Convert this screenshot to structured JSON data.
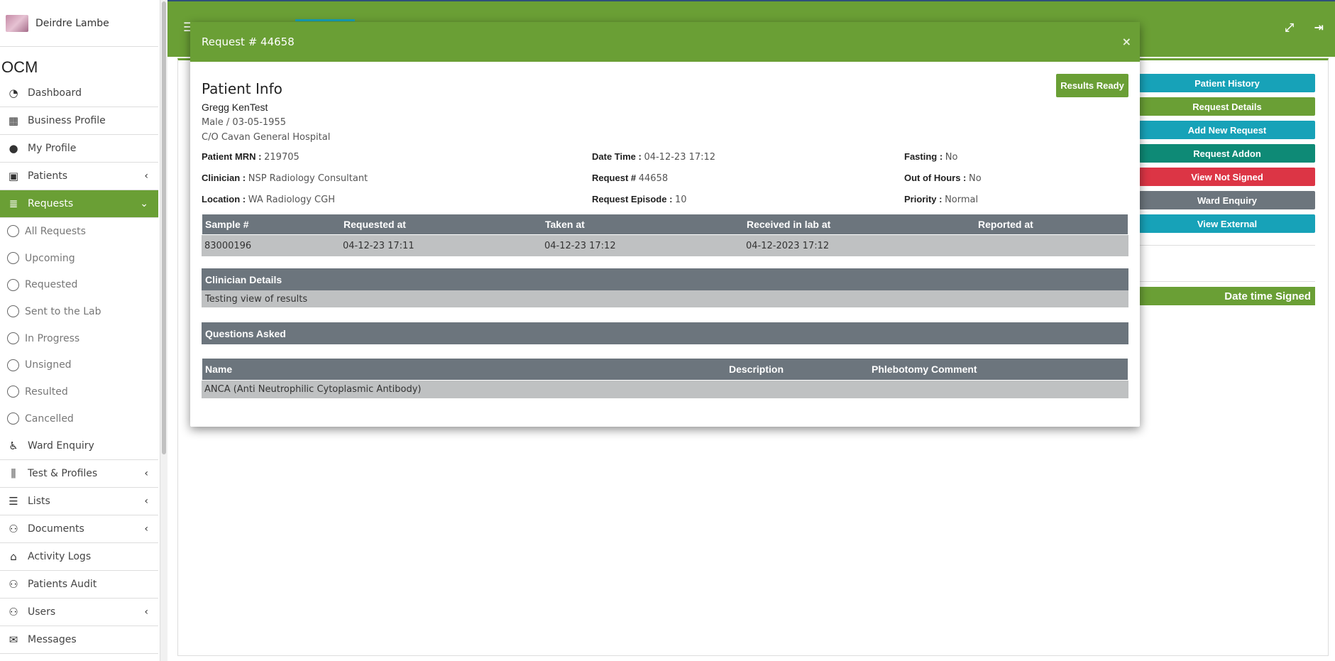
{
  "sidebar": {
    "user_name": "Deirdre Lambe",
    "brand": "OCM",
    "items": {
      "dashboard": "Dashboard",
      "business_profile": "Business Profile",
      "my_profile": "My Profile",
      "patients": "Patients",
      "requests": "Requests",
      "ward_enquiry": "Ward Enquiry",
      "test_profiles": "Test & Profiles",
      "lists": "Lists",
      "documents": "Documents",
      "activity_logs": "Activity Logs",
      "patients_audit": "Patients Audit",
      "users": "Users",
      "messages": "Messages"
    },
    "sub_items": {
      "all": "All Requests",
      "upcoming": "Upcoming",
      "requested": "Requested",
      "sent": "Sent to the Lab",
      "in_progress": "In Progress",
      "unsigned": "Unsigned",
      "resulted": "Resulted",
      "cancelled": "Cancelled"
    }
  },
  "right_panel": {
    "buttons": [
      {
        "label": "Patient History",
        "color": "#17a2b8"
      },
      {
        "label": "Request Details",
        "color": "#6a9f35"
      },
      {
        "label": "Add New Request",
        "color": "#17a2b8"
      },
      {
        "label": "Request Addon",
        "color": "#0e8a76"
      },
      {
        "label": "View Not Signed",
        "color": "#dc3545"
      },
      {
        "label": "Ward Enquiry",
        "color": "#6c757d"
      },
      {
        "label": "View External",
        "color": "#17a2b8"
      }
    ],
    "date_time_signed": "Date time Signed"
  },
  "modal": {
    "title": "Request # 44658",
    "close_glyph": "×",
    "section_title": "Patient Info",
    "results_ready": "Results Ready",
    "patient_name": "Gregg KenTest",
    "gender_dob": "Male / 03-05-1955",
    "hospital": "C/O Cavan General Hospital",
    "fields": {
      "mrn_label": "Patient MRN : ",
      "mrn": "219705",
      "datetime_label": "Date Time : ",
      "datetime": "04-12-23 17:12",
      "fasting_label": "Fasting : ",
      "fasting": "No",
      "clinician_label": "Clinician : ",
      "clinician": "NSP Radiology Consultant",
      "request_label": "Request # ",
      "request": "44658",
      "ooh_label": "Out of Hours : ",
      "ooh": "No",
      "location_label": "Location : ",
      "location": "WA Radiology CGH",
      "episode_label": "Request Episode : ",
      "episode": "10",
      "priority_label": "Priority : ",
      "priority": "Normal"
    },
    "sample_table": {
      "headers": [
        "Sample #",
        "Requested at",
        "Taken at",
        "Received in lab at",
        "Reported at"
      ],
      "row": [
        "83000196",
        "04-12-23 17:11",
        "04-12-23 17:12",
        "04-12-2023 17:12",
        ""
      ]
    },
    "clinician_details_title": "Clinician Details",
    "clinician_details_text": "Testing view of results",
    "questions_title": "Questions Asked",
    "tests_table": {
      "headers": [
        "Name",
        "Description",
        "Phlebotomy Comment"
      ],
      "row": [
        "ANCA (Anti Neutrophilic Cytoplasmic Antibody)",
        "",
        ""
      ]
    }
  }
}
